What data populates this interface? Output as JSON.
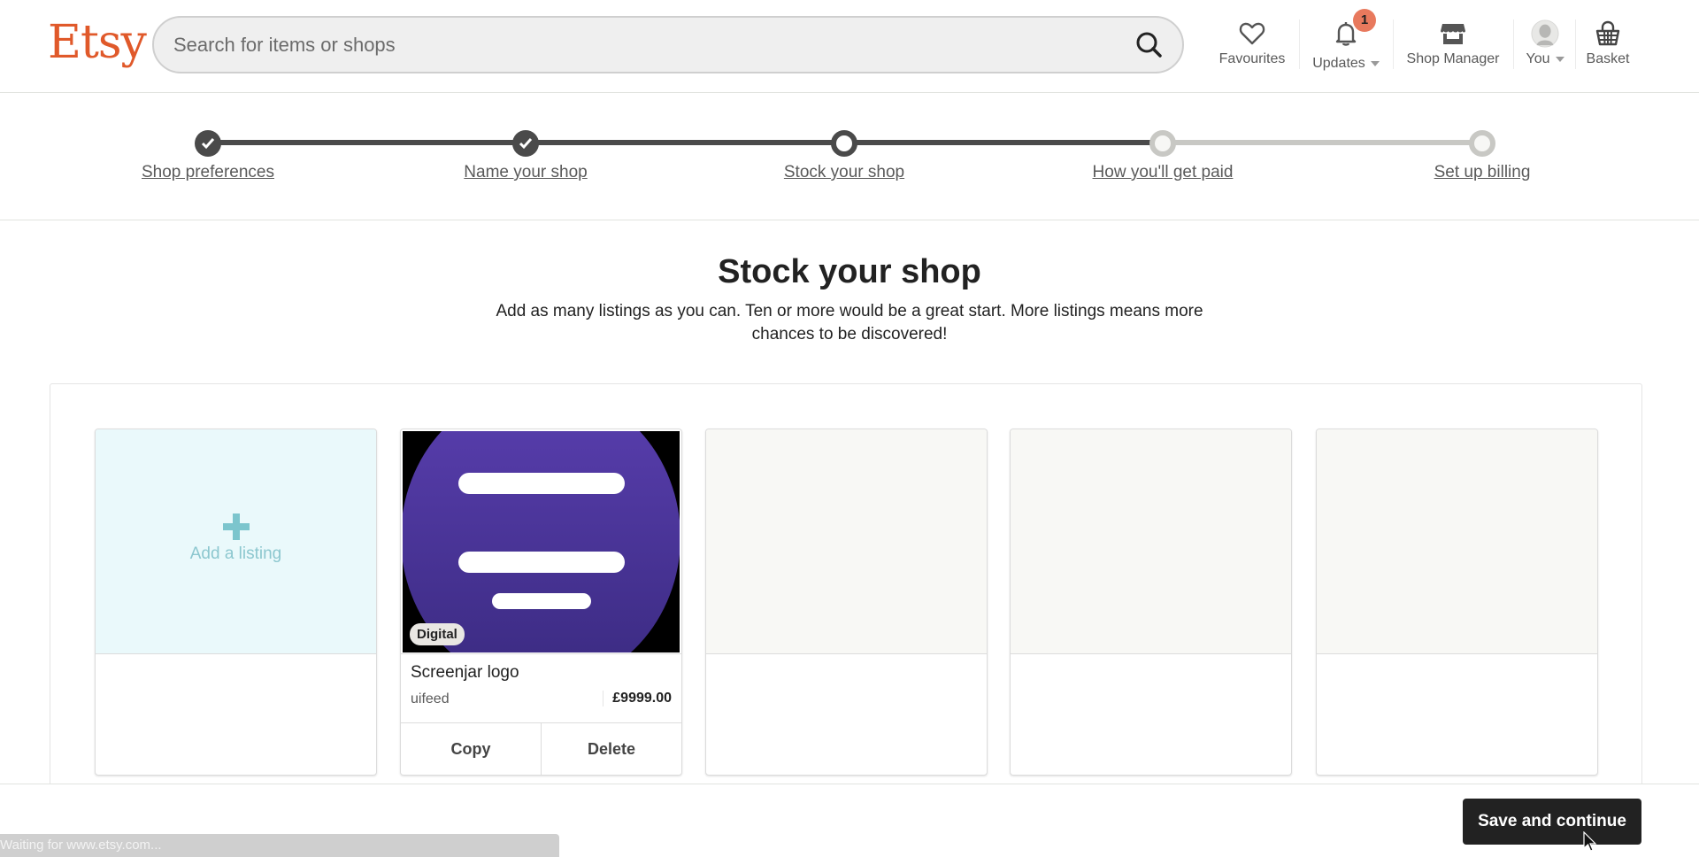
{
  "header": {
    "logo": "Etsy",
    "search_placeholder": "Search for items or shops",
    "search_value": "",
    "nav": [
      {
        "id": "favourites",
        "label": "Favourites",
        "icon": "heart-icon"
      },
      {
        "id": "updates",
        "label": "Updates",
        "icon": "bell-icon",
        "badge": "1",
        "has_dropdown": true
      },
      {
        "id": "shop-manager",
        "label": "Shop Manager",
        "icon": "storefront-icon"
      },
      {
        "id": "you",
        "label": "You",
        "icon": "avatar-icon",
        "has_dropdown": true
      },
      {
        "id": "basket",
        "label": "Basket",
        "icon": "basket-icon"
      }
    ],
    "colors": {
      "brand": "#e0592a",
      "badge": "#e8795d"
    }
  },
  "stepper": {
    "steps": [
      {
        "label": "Shop preferences",
        "state": "done"
      },
      {
        "label": "Name your shop",
        "state": "done"
      },
      {
        "label": "Stock your shop",
        "state": "current"
      },
      {
        "label": "How you'll get paid",
        "state": "todo"
      },
      {
        "label": "Set up billing",
        "state": "todo"
      }
    ]
  },
  "main": {
    "title": "Stock your shop",
    "subtitle": "Add as many listings as you can. Ten or more would be a great start. More listings means more chances to be discovered!",
    "add_listing_label": "Add a listing",
    "listings": [
      {
        "title": "Screenjar logo",
        "shop": "uifeed",
        "price": "£9999.00",
        "badge": "Digital",
        "copy_label": "Copy",
        "delete_label": "Delete"
      }
    ],
    "empty_slots": 3
  },
  "footer": {
    "save_label": "Save and continue"
  },
  "status_bar": {
    "text": "Waiting for www.etsy.com..."
  }
}
